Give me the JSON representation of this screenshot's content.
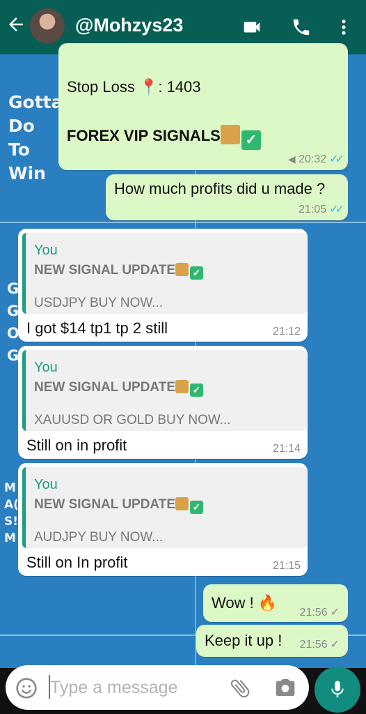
{
  "header": {
    "contact_name": "@Mohzys23"
  },
  "wallpaper": {
    "gotta_lines": [
      "Gotta",
      "Do",
      "To",
      "Win"
    ],
    "g_lines": [
      "G",
      "G",
      "O",
      "G"
    ],
    "m_lines": [
      "M",
      "A(",
      "S!",
      "M"
    ]
  },
  "messages": {
    "m1": {
      "line1": "Stop Loss 📍: 1403",
      "line2": "FOREX VIP SIGNALS",
      "time": "20:32"
    },
    "m2": {
      "text": "How much profits did u made ?",
      "time": "21:05"
    },
    "m3": {
      "quote_author": "You",
      "quote_title": "NEW SIGNAL UPDATE",
      "quote_body": "USDJPY BUY NOW...",
      "text": "I got $14 tp1 tp 2 still",
      "time": "21:12"
    },
    "m4": {
      "quote_author": "You",
      "quote_title": "NEW SIGNAL UPDATE",
      "quote_body": "XAUUSD OR GOLD BUY NOW...",
      "text": "Still on in profit",
      "time": "21:14"
    },
    "m5": {
      "quote_author": "You",
      "quote_title": "NEW SIGNAL UPDATE",
      "quote_body": "AUDJPY BUY NOW...",
      "text": "Still on In profit",
      "time": "21:15"
    },
    "m6": {
      "text": "Wow ! 🔥",
      "time": "21:56"
    },
    "m7": {
      "text": "Keep it up !",
      "time": "21:56"
    }
  },
  "composer": {
    "placeholder": "Type a message"
  },
  "icons": [
    "back-arrow-icon",
    "avatar",
    "video-call-icon",
    "phone-icon",
    "more-options-icon",
    "emoji-icon",
    "attach-icon",
    "camera-icon",
    "mic-icon"
  ],
  "colors": {
    "header": "#075e54",
    "outgoing_bubble": "#dcf8c6",
    "incoming_bubble": "#ffffff",
    "quote_accent": "#1a9e86",
    "read_ticks": "#34b7f1",
    "mic_button": "#128c7e"
  }
}
